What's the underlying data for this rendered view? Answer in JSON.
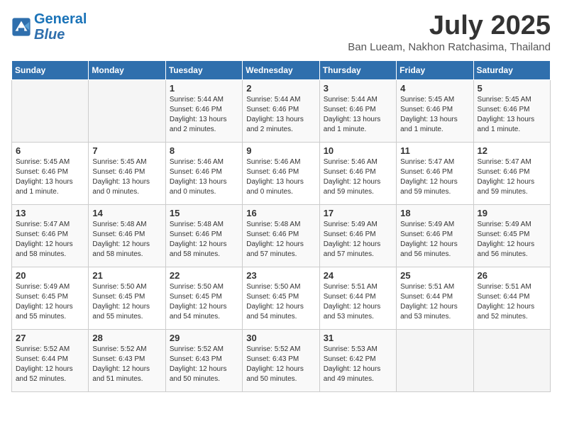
{
  "header": {
    "logo_line1": "General",
    "logo_line2": "Blue",
    "month_year": "July 2025",
    "location": "Ban Lueam, Nakhon Ratchasima, Thailand"
  },
  "days_of_week": [
    "Sunday",
    "Monday",
    "Tuesday",
    "Wednesday",
    "Thursday",
    "Friday",
    "Saturday"
  ],
  "weeks": [
    [
      {
        "day": "",
        "info": ""
      },
      {
        "day": "",
        "info": ""
      },
      {
        "day": "1",
        "info": "Sunrise: 5:44 AM\nSunset: 6:46 PM\nDaylight: 13 hours and 2 minutes."
      },
      {
        "day": "2",
        "info": "Sunrise: 5:44 AM\nSunset: 6:46 PM\nDaylight: 13 hours and 2 minutes."
      },
      {
        "day": "3",
        "info": "Sunrise: 5:44 AM\nSunset: 6:46 PM\nDaylight: 13 hours and 1 minute."
      },
      {
        "day": "4",
        "info": "Sunrise: 5:45 AM\nSunset: 6:46 PM\nDaylight: 13 hours and 1 minute."
      },
      {
        "day": "5",
        "info": "Sunrise: 5:45 AM\nSunset: 6:46 PM\nDaylight: 13 hours and 1 minute."
      }
    ],
    [
      {
        "day": "6",
        "info": "Sunrise: 5:45 AM\nSunset: 6:46 PM\nDaylight: 13 hours and 1 minute."
      },
      {
        "day": "7",
        "info": "Sunrise: 5:45 AM\nSunset: 6:46 PM\nDaylight: 13 hours and 0 minutes."
      },
      {
        "day": "8",
        "info": "Sunrise: 5:46 AM\nSunset: 6:46 PM\nDaylight: 13 hours and 0 minutes."
      },
      {
        "day": "9",
        "info": "Sunrise: 5:46 AM\nSunset: 6:46 PM\nDaylight: 13 hours and 0 minutes."
      },
      {
        "day": "10",
        "info": "Sunrise: 5:46 AM\nSunset: 6:46 PM\nDaylight: 12 hours and 59 minutes."
      },
      {
        "day": "11",
        "info": "Sunrise: 5:47 AM\nSunset: 6:46 PM\nDaylight: 12 hours and 59 minutes."
      },
      {
        "day": "12",
        "info": "Sunrise: 5:47 AM\nSunset: 6:46 PM\nDaylight: 12 hours and 59 minutes."
      }
    ],
    [
      {
        "day": "13",
        "info": "Sunrise: 5:47 AM\nSunset: 6:46 PM\nDaylight: 12 hours and 58 minutes."
      },
      {
        "day": "14",
        "info": "Sunrise: 5:48 AM\nSunset: 6:46 PM\nDaylight: 12 hours and 58 minutes."
      },
      {
        "day": "15",
        "info": "Sunrise: 5:48 AM\nSunset: 6:46 PM\nDaylight: 12 hours and 58 minutes."
      },
      {
        "day": "16",
        "info": "Sunrise: 5:48 AM\nSunset: 6:46 PM\nDaylight: 12 hours and 57 minutes."
      },
      {
        "day": "17",
        "info": "Sunrise: 5:49 AM\nSunset: 6:46 PM\nDaylight: 12 hours and 57 minutes."
      },
      {
        "day": "18",
        "info": "Sunrise: 5:49 AM\nSunset: 6:46 PM\nDaylight: 12 hours and 56 minutes."
      },
      {
        "day": "19",
        "info": "Sunrise: 5:49 AM\nSunset: 6:45 PM\nDaylight: 12 hours and 56 minutes."
      }
    ],
    [
      {
        "day": "20",
        "info": "Sunrise: 5:49 AM\nSunset: 6:45 PM\nDaylight: 12 hours and 55 minutes."
      },
      {
        "day": "21",
        "info": "Sunrise: 5:50 AM\nSunset: 6:45 PM\nDaylight: 12 hours and 55 minutes."
      },
      {
        "day": "22",
        "info": "Sunrise: 5:50 AM\nSunset: 6:45 PM\nDaylight: 12 hours and 54 minutes."
      },
      {
        "day": "23",
        "info": "Sunrise: 5:50 AM\nSunset: 6:45 PM\nDaylight: 12 hours and 54 minutes."
      },
      {
        "day": "24",
        "info": "Sunrise: 5:51 AM\nSunset: 6:44 PM\nDaylight: 12 hours and 53 minutes."
      },
      {
        "day": "25",
        "info": "Sunrise: 5:51 AM\nSunset: 6:44 PM\nDaylight: 12 hours and 53 minutes."
      },
      {
        "day": "26",
        "info": "Sunrise: 5:51 AM\nSunset: 6:44 PM\nDaylight: 12 hours and 52 minutes."
      }
    ],
    [
      {
        "day": "27",
        "info": "Sunrise: 5:52 AM\nSunset: 6:44 PM\nDaylight: 12 hours and 52 minutes."
      },
      {
        "day": "28",
        "info": "Sunrise: 5:52 AM\nSunset: 6:43 PM\nDaylight: 12 hours and 51 minutes."
      },
      {
        "day": "29",
        "info": "Sunrise: 5:52 AM\nSunset: 6:43 PM\nDaylight: 12 hours and 50 minutes."
      },
      {
        "day": "30",
        "info": "Sunrise: 5:52 AM\nSunset: 6:43 PM\nDaylight: 12 hours and 50 minutes."
      },
      {
        "day": "31",
        "info": "Sunrise: 5:53 AM\nSunset: 6:42 PM\nDaylight: 12 hours and 49 minutes."
      },
      {
        "day": "",
        "info": ""
      },
      {
        "day": "",
        "info": ""
      }
    ]
  ]
}
